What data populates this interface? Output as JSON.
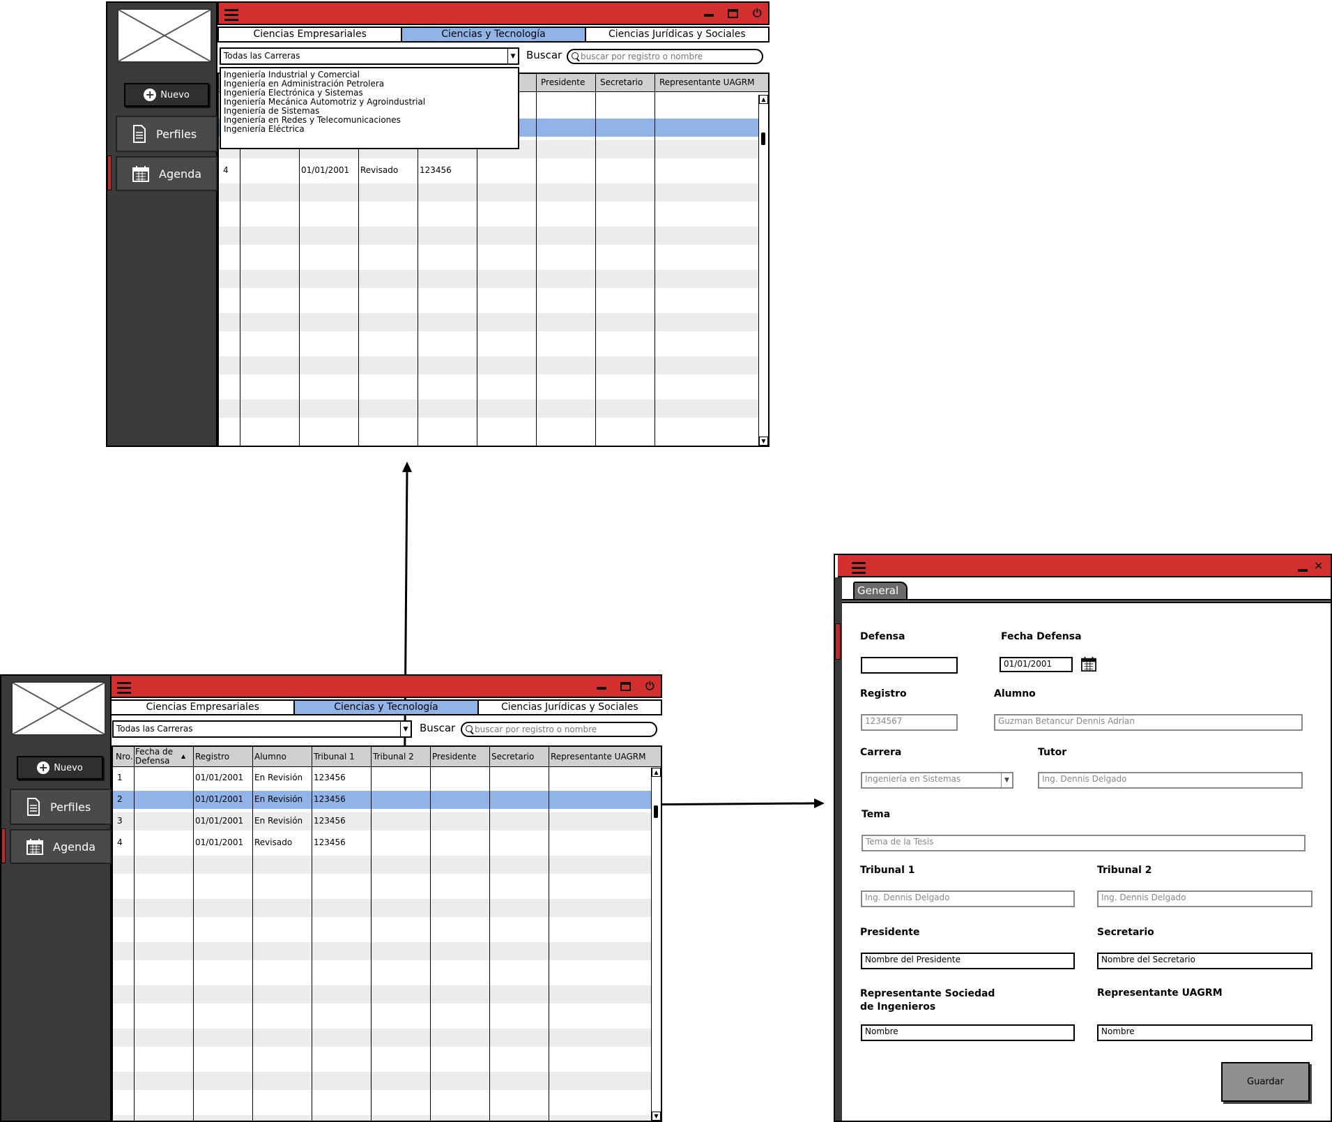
{
  "app": {
    "sidebar": {
      "new_button": "Nuevo",
      "items": [
        {
          "label": "Perfiles",
          "icon": "document-icon"
        },
        {
          "label": "Agenda",
          "icon": "calendar-icon"
        }
      ]
    },
    "tabs": [
      "Ciencias Empresariales",
      "Ciencias y Tecnología",
      "Ciencias Jurídicas y Sociales"
    ],
    "selected_tab": "Ciencias y Tecnología",
    "career_filter": "Todas las Carreras",
    "search_label": "Buscar",
    "search_placeholder": "buscar por registro o nombre",
    "table": {
      "headers": [
        "Nro.",
        "Fecha de Defensa",
        "Registro",
        "Alumno",
        "Tribunal 1",
        "Tribunal 2",
        "Presidente",
        "Secretario",
        "Representante UAGRM"
      ],
      "rows": [
        {
          "nro": "1",
          "registro": "01/01/2001",
          "alumno": "En Revisión",
          "tribunal1": "123456"
        },
        {
          "nro": "2",
          "registro": "01/01/2001",
          "alumno": "En Revisión",
          "tribunal1": "123456"
        },
        {
          "nro": "3",
          "registro": "01/01/2001",
          "alumno": "En Revisión",
          "tribunal1": "123456"
        },
        {
          "nro": "4",
          "registro": "01/01/2001",
          "alumno": "Revisado",
          "tribunal1": "123456"
        }
      ],
      "selected_row": 2
    },
    "career_options": [
      "Ingeniería Industrial y Comercial",
      "Ingeniería en Administración Petrolera",
      "Ingeniería Electrónica y Sistemas",
      "Ingeniería Mecánica Automotriz y Agroindustrial",
      "Ingeniería de Sistemas",
      "Ingeniería en Redes y Telecomunicaciones",
      "Ingeniería Eléctrica"
    ]
  },
  "form": {
    "tab": "General",
    "fields": {
      "defensa": {
        "label": "Defensa",
        "value": ""
      },
      "fecha_defensa": {
        "label": "Fecha Defensa",
        "value": "01/01/2001"
      },
      "registro": {
        "label": "Registro",
        "placeholder": "1234567"
      },
      "alumno": {
        "label": "Alumno",
        "placeholder": "Guzman Betancur Dennis Adrian"
      },
      "carrera": {
        "label": "Carrera",
        "placeholder": "Ingeniería en Sistemas"
      },
      "tutor": {
        "label": "Tutor",
        "placeholder": "Ing. Dennis Delgado"
      },
      "tema": {
        "label": "Tema",
        "placeholder": "Tema de la Tesis"
      },
      "tribunal1": {
        "label": "Tribunal 1",
        "placeholder": "Ing. Dennis Delgado"
      },
      "tribunal2": {
        "label": "Tribunal 2",
        "placeholder": "Ing. Dennis Delgado"
      },
      "presidente": {
        "label": "Presidente",
        "value": "Nombre del Presidente"
      },
      "secretario": {
        "label": "Secretario",
        "value": "Nombre del Secretario"
      },
      "rep_sociedad": {
        "label_line1": "Representante Sociedad",
        "label_line2": "de Ingenieros",
        "value": "Nombre"
      },
      "rep_uagrm": {
        "label": "Representante UAGRM",
        "value": "Nombre"
      }
    },
    "save_button": "Guardar"
  },
  "colors": {
    "titlebar": "#d32f2f",
    "selection": "#90b4e8",
    "sidebar": "#3a3a3a"
  }
}
